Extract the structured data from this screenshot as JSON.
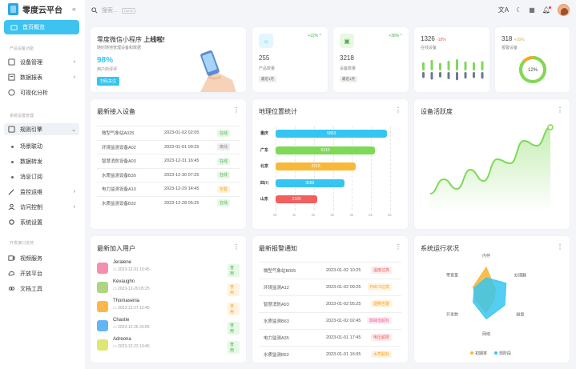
{
  "app": {
    "title": "零度云平台",
    "search_placeholder": "搜索...",
    "search_kbd": "Ctrl+K"
  },
  "sidebar": {
    "active": "首页概览",
    "group1": "产品设备功能",
    "items1": [
      "设备管理",
      "数据报表",
      "可视化分析"
    ],
    "group2": "系统设置管理",
    "rules": "规则引擎",
    "subs": [
      "场景联动",
      "数据转发",
      "消息订阅"
    ],
    "items2": [
      "监控运维",
      "访问控制",
      "系统设置"
    ],
    "group3": "开发接口支持",
    "items3": [
      "视频服务",
      "开放平台",
      "文档工具"
    ]
  },
  "welcome": {
    "title_pre": "零度微信小程序",
    "title_bold": "上线啦!",
    "subtitle": "随时随地管理设备和数据",
    "percent": "98%",
    "percent_label": "用户的评评",
    "button": "扫码关注"
  },
  "stats": [
    {
      "delta": "+22% ^",
      "value": "255",
      "label": "产品数量",
      "btn": "最近1月"
    },
    {
      "delta": "+38% ^",
      "value": "3218",
      "label": "设备数量",
      "btn": "最近1月"
    }
  ],
  "online": {
    "value": "1326",
    "delta": "-18%",
    "label": "在线设备",
    "bars": [
      0.55,
      0.7,
      0.5,
      0.65,
      0.75,
      0.6,
      0.55,
      0.62
    ]
  },
  "alarm": {
    "value": "318",
    "delta": "+16%",
    "label": "报警设备",
    "gauge_label": "12%",
    "gauge": 0.12
  },
  "recent_devices": {
    "title": "最新接入设备",
    "rows": [
      {
        "name": "微型气象站A025",
        "time": "2023-01-02 02:05",
        "status": "在线",
        "color": "green"
      },
      {
        "name": "环境监测设备A02",
        "time": "2023-01-01 09:25",
        "status": "离线",
        "color": "gray"
      },
      {
        "name": "智慧消防设备A03",
        "time": "2023-12-31 16:45",
        "status": "在线",
        "color": "green"
      },
      {
        "name": "水质监测设备B30",
        "time": "2023-12-30 07:25",
        "status": "在线",
        "color": "green"
      },
      {
        "name": "电力监测设备A10",
        "time": "2023-12-29 14:45",
        "status": "告警",
        "color": "orange"
      },
      {
        "name": "水质监测设备B32",
        "time": "2023-12-28 05:25",
        "status": "在线",
        "color": "green"
      }
    ]
  },
  "geo": {
    "title": "地理位置统计",
    "chart_data": {
      "type": "bar",
      "orientation": "horizontal",
      "categories": [
        "重庆",
        "广东",
        "北京",
        "四川",
        "山东"
      ],
      "values": [
        5853,
        5210,
        4215,
        3589,
        2186
      ],
      "colors": [
        "#36c5f0",
        "#7ed957",
        "#f8b93b",
        "#36c5f0",
        "#f25f5c"
      ],
      "xlim": [
        0,
        6000
      ],
      "xticks": [
        "0k",
        "1k",
        "2k",
        "3k",
        "4k",
        "5k",
        "6k"
      ],
      "grid": true
    }
  },
  "activity": {
    "title": "设备活跃度",
    "chart_data": {
      "type": "area",
      "values": [
        0.12,
        0.3,
        0.18,
        0.42,
        0.28,
        0.55,
        0.5,
        0.78,
        0.72,
        0.95
      ]
    }
  },
  "recent_users": {
    "title": "最新加入用户",
    "rows": [
      {
        "name": "Jeralene",
        "time": "2023-12-31 16:45",
        "tag": "普用",
        "color": "green",
        "av": "#f48fb1"
      },
      {
        "name": "Kevaughn",
        "time": "2023-12-29 05:25",
        "tag": "普用",
        "color": "orange",
        "av": "#aed581"
      },
      {
        "name": "Thomasenia",
        "time": "2023-12-27 12:45",
        "tag": "普用",
        "color": "orange",
        "av": "#ffb74d"
      },
      {
        "name": "Chastie",
        "time": "2023-12-26 20:05",
        "tag": "普用",
        "color": "green",
        "av": "#64b5f6"
      },
      {
        "name": "Adreona",
        "time": "2023-12-23 10:45",
        "tag": "普用",
        "color": "green",
        "av": "#dce775"
      }
    ]
  },
  "alarms": {
    "title": "最新报警通知",
    "rows": [
      {
        "name": "微型气象站B005",
        "time": "2023-01-02 10:25",
        "status": "温度过高",
        "color": "red"
      },
      {
        "name": "环境监测A12",
        "time": "2023-01-02 09:25",
        "status": "PM2.5过高",
        "color": "orange"
      },
      {
        "name": "智慧消防A93",
        "time": "2023-01-02 05:25",
        "status": "烟雾告警",
        "color": "orange"
      },
      {
        "name": "水质监测B63",
        "time": "2023-01-02 02:45",
        "status": "酸碱值超标",
        "color": "pink"
      },
      {
        "name": "电力监测A35",
        "time": "2023-01-01 17:45",
        "status": "电压超限",
        "color": "red"
      },
      {
        "name": "水质监测B62",
        "time": "2023-01-01 16:05",
        "status": "水质超标",
        "color": "orange"
      }
    ]
  },
  "system": {
    "title": "系统运行状况",
    "chart_data": {
      "type": "radar",
      "axes": [
        "内存",
        "处理器",
        "磁盘",
        "网络",
        "开发数",
        "带宽量"
      ],
      "series": [
        {
          "name": "初期率",
          "values": [
            0.9,
            0.35,
            0.3,
            0.6,
            0.4,
            0.5
          ],
          "color": "#f5b83d"
        },
        {
          "name": "现阶段",
          "values": [
            0.55,
            0.75,
            0.7,
            0.8,
            0.5,
            0.45
          ],
          "color": "#36c5f0"
        }
      ]
    }
  }
}
